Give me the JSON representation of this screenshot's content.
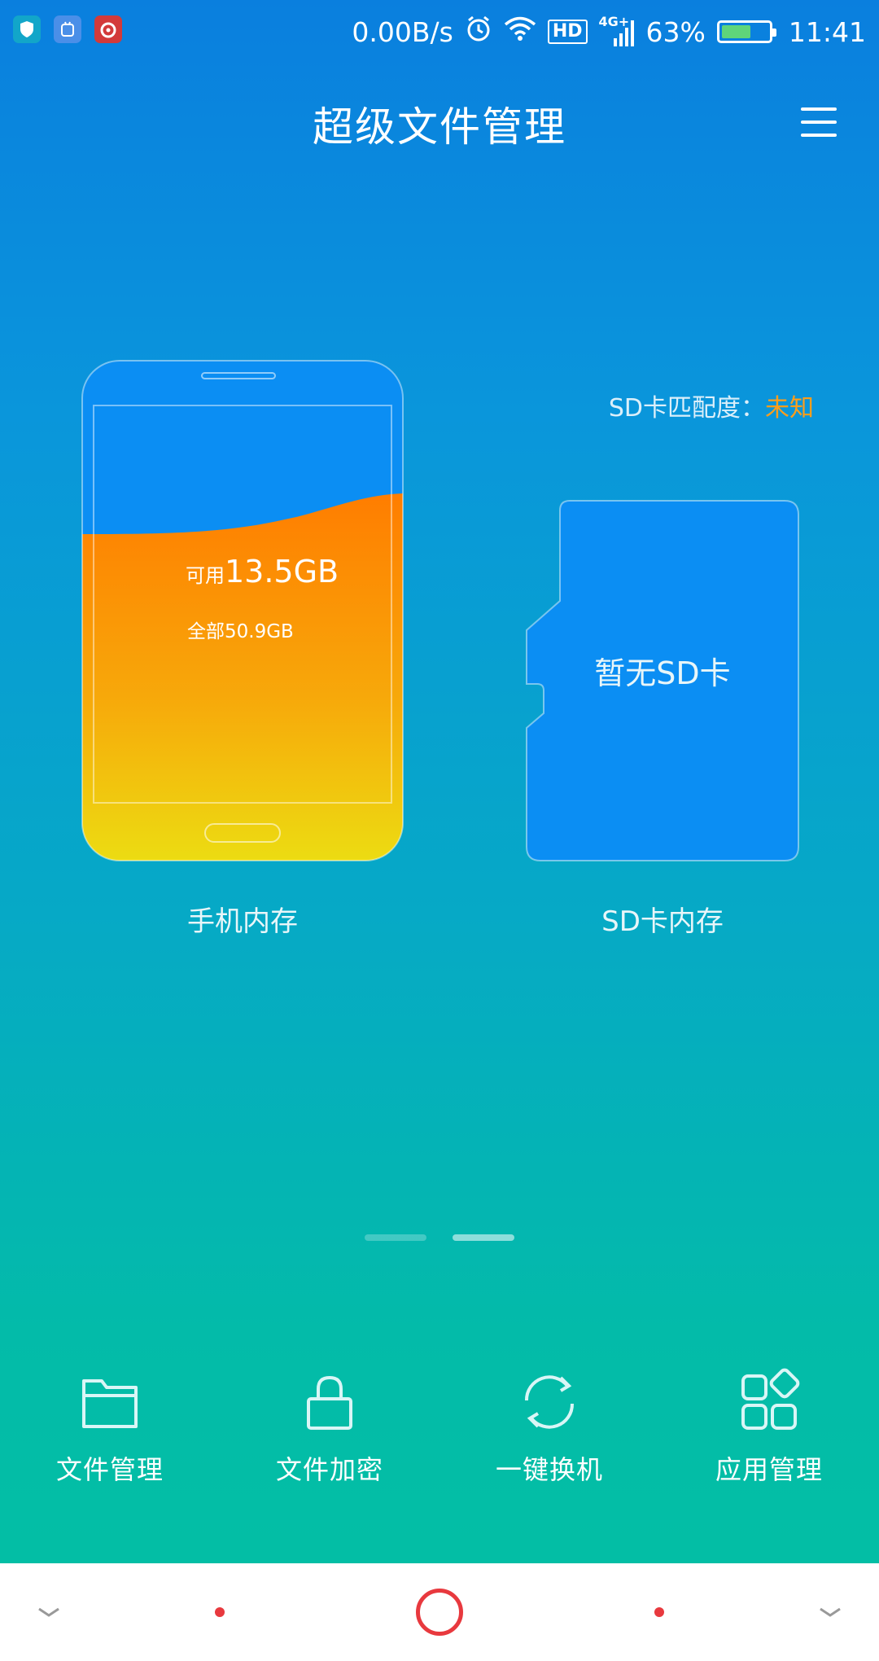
{
  "status_bar": {
    "net_speed": "0.00B/s",
    "hd": "HD",
    "signal_type": "4G+",
    "battery_percent": "63%",
    "battery_level": 0.63,
    "time": "11:41",
    "notification_icons": [
      "shield-app-icon",
      "android-app-icon",
      "netease-music-icon"
    ]
  },
  "header": {
    "title": "超级文件管理",
    "menu_icon": "menu-icon"
  },
  "phone_storage": {
    "available_prefix": "可用",
    "available_value": "13.5GB",
    "total_label": "全部50.9GB",
    "label": "手机内存"
  },
  "sd_storage": {
    "match_label": "SD卡匹配度：",
    "match_value": "未知",
    "empty_text": "暂无SD卡",
    "label": "SD卡内存"
  },
  "page_indicator": {
    "count": 2,
    "active_index": 1
  },
  "tools": [
    {
      "label": "文件管理",
      "icon": "folder-icon"
    },
    {
      "label": "文件加密",
      "icon": "lock-icon"
    },
    {
      "label": "一键换机",
      "icon": "sync-icon"
    },
    {
      "label": "应用管理",
      "icon": "apps-grid-icon"
    }
  ],
  "colors": {
    "accent_orange": "#ff9e1b",
    "sd_card_blue": "#0b8ef3",
    "nav_red": "#e8393e"
  }
}
